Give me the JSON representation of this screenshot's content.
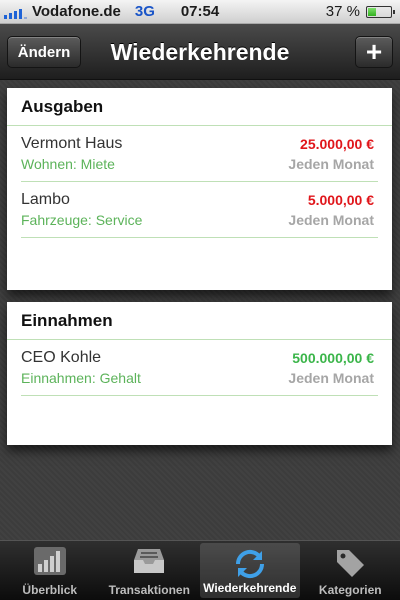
{
  "status_bar": {
    "carrier": "Vodafone.de",
    "network": "3G",
    "time": "07:54",
    "battery": "37 %",
    "battery_level": 0.37,
    "signal_bars": 4
  },
  "nav": {
    "edit_label": "Ändern",
    "title": "Wiederkehrende",
    "add_label": "+"
  },
  "sections": [
    {
      "title": "Ausgaben",
      "items": [
        {
          "name": "Vermont Haus",
          "category": "Wohnen: Miete",
          "amount": "25.000,00 €",
          "frequency": "Jeden Monat"
        },
        {
          "name": "Lambo",
          "category": "Fahrzeuge: Service",
          "amount": "5.000,00 €",
          "frequency": "Jeden Monat"
        }
      ]
    },
    {
      "title": "Einnahmen",
      "items": [
        {
          "name": "CEO Kohle",
          "category": "Einnahmen: Gehalt",
          "amount": "500.000,00 €",
          "frequency": "Jeden Monat"
        }
      ]
    }
  ],
  "tabs": [
    {
      "label": "Überblick",
      "icon": "bar-chart-icon",
      "active": false
    },
    {
      "label": "Transaktionen",
      "icon": "inbox-tray-icon",
      "active": false
    },
    {
      "label": "Wiederkehrende",
      "icon": "refresh-arrows-icon",
      "active": true
    },
    {
      "label": "Kategorien",
      "icon": "tag-icon",
      "active": false
    }
  ],
  "colors": {
    "expense": "#e0161b",
    "income": "#3bb54a",
    "category": "#5cb35a",
    "active_tab_icon": "#3fa0e8"
  }
}
